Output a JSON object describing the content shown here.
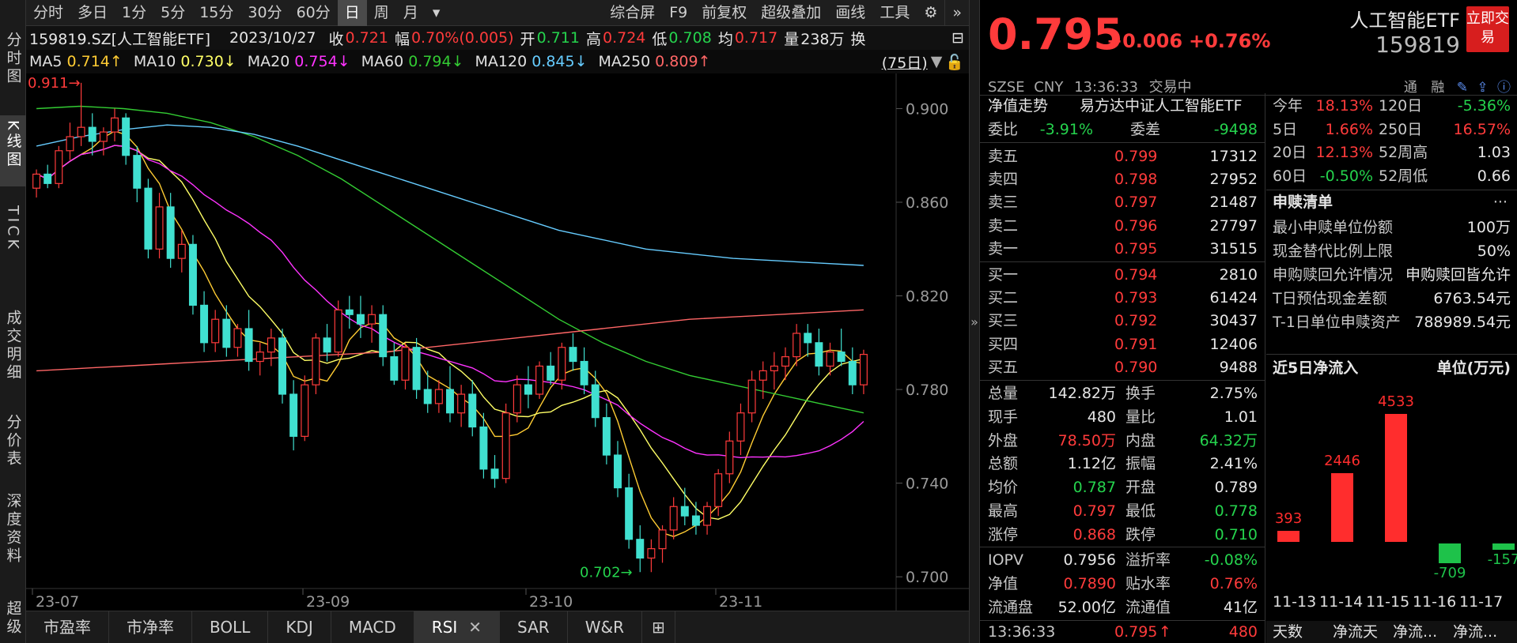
{
  "left_nav": [
    {
      "label": "分时图",
      "active": false
    },
    {
      "label": "K线图",
      "active": true
    },
    {
      "label": "TICK",
      "active": false
    },
    {
      "label": "成交明细",
      "active": false
    },
    {
      "label": "分价表",
      "active": false
    },
    {
      "label": "深度资料",
      "active": false
    },
    {
      "label": "超级",
      "active": false
    }
  ],
  "period_tabs": [
    "分时",
    "多日",
    "1分",
    "5分",
    "15分",
    "30分",
    "60分",
    "日",
    "周",
    "月",
    "▾"
  ],
  "period_active": "日",
  "toolbar": [
    "综合屏",
    "F9",
    "前复权",
    "超级叠加",
    "画线",
    "工具"
  ],
  "info": {
    "code": "159819.SZ[人工智能ETF]",
    "date": "2023/10/27",
    "close_label": "收",
    "close": "0.721",
    "amp_label": "幅",
    "amp": "0.70%(0.005)",
    "open_label": "开",
    "open": "0.711",
    "high_label": "高",
    "high": "0.724",
    "low_label": "低",
    "low": "0.708",
    "avg_label": "均",
    "avg": "0.717",
    "vol_label": "量",
    "vol": "238万",
    "turn_label": "换"
  },
  "ma": [
    {
      "label": "MA5",
      "value": "0.714↑",
      "color": "#ffcc33"
    },
    {
      "label": "MA10",
      "value": "0.730↓",
      "color": "#ffff66"
    },
    {
      "label": "MA20",
      "value": "0.754↓",
      "color": "#ff33ff"
    },
    {
      "label": "MA60",
      "value": "0.794↓",
      "color": "#33cc33"
    },
    {
      "label": "MA120",
      "value": "0.845↓",
      "color": "#66ccff"
    },
    {
      "label": "MA250",
      "value": "0.809↑",
      "color": "#ff6666"
    }
  ],
  "ma_days": "(75日)",
  "chart_data": {
    "type": "candlestick",
    "ylim": [
      0.695,
      0.915
    ],
    "yticks": [
      "0.900",
      "0.860",
      "0.820",
      "0.780",
      "0.740",
      "0.700"
    ],
    "xticks": [
      "23-07",
      "23-09",
      "23-10",
      "23-11"
    ],
    "max_label": "0.911→",
    "min_label": "0.702→",
    "candles": [
      [
        0.866,
        0.874,
        0.862,
        0.872
      ],
      [
        0.872,
        0.876,
        0.866,
        0.868
      ],
      [
        0.868,
        0.884,
        0.866,
        0.882
      ],
      [
        0.882,
        0.894,
        0.878,
        0.888
      ],
      [
        0.888,
        0.911,
        0.884,
        0.892
      ],
      [
        0.892,
        0.898,
        0.88,
        0.886
      ],
      [
        0.886,
        0.892,
        0.88,
        0.89
      ],
      [
        0.89,
        0.9,
        0.886,
        0.896
      ],
      [
        0.896,
        0.898,
        0.876,
        0.88
      ],
      [
        0.88,
        0.884,
        0.86,
        0.866
      ],
      [
        0.866,
        0.87,
        0.836,
        0.84
      ],
      [
        0.84,
        0.864,
        0.836,
        0.858
      ],
      [
        0.858,
        0.864,
        0.832,
        0.836
      ],
      [
        0.836,
        0.848,
        0.83,
        0.842
      ],
      [
        0.842,
        0.846,
        0.812,
        0.816
      ],
      [
        0.816,
        0.822,
        0.796,
        0.8
      ],
      [
        0.8,
        0.814,
        0.796,
        0.81
      ],
      [
        0.81,
        0.816,
        0.794,
        0.798
      ],
      [
        0.798,
        0.808,
        0.794,
        0.806
      ],
      [
        0.806,
        0.814,
        0.788,
        0.792
      ],
      [
        0.792,
        0.8,
        0.786,
        0.796
      ],
      [
        0.796,
        0.806,
        0.79,
        0.802
      ],
      [
        0.802,
        0.806,
        0.774,
        0.778
      ],
      [
        0.778,
        0.784,
        0.754,
        0.76
      ],
      [
        0.76,
        0.786,
        0.758,
        0.782
      ],
      [
        0.782,
        0.804,
        0.778,
        0.802
      ],
      [
        0.802,
        0.808,
        0.792,
        0.796
      ],
      [
        0.796,
        0.818,
        0.794,
        0.814
      ],
      [
        0.814,
        0.82,
        0.806,
        0.812
      ],
      [
        0.812,
        0.82,
        0.802,
        0.808
      ],
      [
        0.808,
        0.816,
        0.8,
        0.812
      ],
      [
        0.812,
        0.816,
        0.79,
        0.794
      ],
      [
        0.794,
        0.8,
        0.782,
        0.784
      ],
      [
        0.784,
        0.8,
        0.78,
        0.798
      ],
      [
        0.798,
        0.802,
        0.776,
        0.78
      ],
      [
        0.78,
        0.788,
        0.77,
        0.774
      ],
      [
        0.774,
        0.784,
        0.77,
        0.78
      ],
      [
        0.78,
        0.79,
        0.766,
        0.77
      ],
      [
        0.77,
        0.782,
        0.764,
        0.778
      ],
      [
        0.778,
        0.784,
        0.76,
        0.764
      ],
      [
        0.764,
        0.77,
        0.742,
        0.746
      ],
      [
        0.746,
        0.752,
        0.738,
        0.742
      ],
      [
        0.742,
        0.774,
        0.74,
        0.77
      ],
      [
        0.77,
        0.786,
        0.766,
        0.782
      ],
      [
        0.782,
        0.79,
        0.772,
        0.778
      ],
      [
        0.778,
        0.792,
        0.776,
        0.79
      ],
      [
        0.79,
        0.796,
        0.782,
        0.784
      ],
      [
        0.784,
        0.8,
        0.78,
        0.798
      ],
      [
        0.798,
        0.804,
        0.788,
        0.792
      ],
      [
        0.792,
        0.798,
        0.778,
        0.782
      ],
      [
        0.782,
        0.788,
        0.764,
        0.768
      ],
      [
        0.768,
        0.774,
        0.748,
        0.752
      ],
      [
        0.752,
        0.758,
        0.734,
        0.738
      ],
      [
        0.738,
        0.744,
        0.712,
        0.716
      ],
      [
        0.716,
        0.722,
        0.702,
        0.708
      ],
      [
        0.708,
        0.716,
        0.702,
        0.712
      ],
      [
        0.712,
        0.722,
        0.706,
        0.72
      ],
      [
        0.72,
        0.734,
        0.716,
        0.73
      ],
      [
        0.73,
        0.738,
        0.722,
        0.726
      ],
      [
        0.726,
        0.732,
        0.718,
        0.722
      ],
      [
        0.722,
        0.732,
        0.718,
        0.73
      ],
      [
        0.73,
        0.746,
        0.726,
        0.744
      ],
      [
        0.744,
        0.762,
        0.74,
        0.758
      ],
      [
        0.758,
        0.774,
        0.752,
        0.77
      ],
      [
        0.77,
        0.788,
        0.766,
        0.784
      ],
      [
        0.784,
        0.792,
        0.776,
        0.788
      ],
      [
        0.788,
        0.796,
        0.78,
        0.79
      ],
      [
        0.79,
        0.798,
        0.784,
        0.794
      ],
      [
        0.794,
        0.808,
        0.79,
        0.804
      ],
      [
        0.804,
        0.808,
        0.794,
        0.8
      ],
      [
        0.8,
        0.806,
        0.786,
        0.79
      ],
      [
        0.79,
        0.8,
        0.786,
        0.796
      ],
      [
        0.796,
        0.806,
        0.79,
        0.792
      ],
      [
        0.792,
        0.798,
        0.778,
        0.782
      ],
      [
        0.782,
        0.797,
        0.778,
        0.795
      ]
    ],
    "ma_lines": [
      {
        "name": "MA5",
        "color": "#ffcc33"
      },
      {
        "name": "MA10",
        "color": "#ffff66"
      },
      {
        "name": "MA20",
        "color": "#ff33ff"
      },
      {
        "name": "MA60",
        "color": "#33cc33",
        "values": [
          0.9,
          0.901,
          0.9,
          0.898,
          0.894,
          0.888,
          0.88,
          0.87,
          0.858,
          0.846,
          0.834,
          0.822,
          0.81,
          0.8,
          0.792,
          0.786,
          0.782,
          0.778,
          0.774,
          0.77
        ]
      },
      {
        "name": "MA120",
        "color": "#66ccff",
        "values": [
          0.884,
          0.888,
          0.891,
          0.893,
          0.892,
          0.889,
          0.884,
          0.878,
          0.872,
          0.866,
          0.86,
          0.854,
          0.848,
          0.844,
          0.84,
          0.838,
          0.836,
          0.835,
          0.834,
          0.833
        ]
      },
      {
        "name": "MA250",
        "color": "#ff6666",
        "values": [
          0.788,
          0.789,
          0.79,
          0.791,
          0.792,
          0.793,
          0.794,
          0.795,
          0.796,
          0.798,
          0.8,
          0.802,
          0.804,
          0.806,
          0.808,
          0.81,
          0.811,
          0.812,
          0.813,
          0.814
        ]
      }
    ]
  },
  "indicator_tabs": [
    "市盈率",
    "市净率",
    "BOLL",
    "KDJ",
    "MACD",
    "RSI",
    "SAR",
    "W&R"
  ],
  "indicator_active": "RSI",
  "quote": {
    "price": "0.795",
    "change": "+0.006",
    "change_pct": "+0.76%",
    "name": "人工智能ETF",
    "code": "159819",
    "trade_btn": "立即交易",
    "exchange": "SZSE",
    "currency": "CNY",
    "time": "13:36:33",
    "status": "交易中",
    "tags": [
      "通",
      "融"
    ]
  },
  "fund": {
    "tab1": "净值走势",
    "tab2": "易方达中证人工智能ETF"
  },
  "weibi": {
    "label1": "委比",
    "value1": "-3.91%",
    "label2": "委差",
    "value2": "-9498"
  },
  "asks": [
    {
      "label": "卖五",
      "price": "0.799",
      "vol": "17312"
    },
    {
      "label": "卖四",
      "price": "0.798",
      "vol": "27952"
    },
    {
      "label": "卖三",
      "price": "0.797",
      "vol": "21487"
    },
    {
      "label": "卖二",
      "price": "0.796",
      "vol": "27797"
    },
    {
      "label": "卖一",
      "price": "0.795",
      "vol": "31515"
    }
  ],
  "bids": [
    {
      "label": "买一",
      "price": "0.794",
      "vol": "2810"
    },
    {
      "label": "买二",
      "price": "0.793",
      "vol": "61424"
    },
    {
      "label": "买三",
      "price": "0.792",
      "vol": "30437"
    },
    {
      "label": "买四",
      "price": "0.791",
      "vol": "12406"
    },
    {
      "label": "买五",
      "price": "0.790",
      "vol": "9488"
    }
  ],
  "stats": [
    {
      "l1": "总量",
      "v1": "142.82万",
      "c1": "white",
      "l2": "换手",
      "v2": "2.75%",
      "c2": "white"
    },
    {
      "l1": "现手",
      "v1": "480",
      "c1": "white",
      "l2": "量比",
      "v2": "1.01",
      "c2": "white"
    },
    {
      "l1": "外盘",
      "v1": "78.50万",
      "c1": "red",
      "l2": "内盘",
      "v2": "64.32万",
      "c2": "green"
    },
    {
      "l1": "总额",
      "v1": "1.12亿",
      "c1": "white",
      "l2": "振幅",
      "v2": "2.41%",
      "c2": "white"
    },
    {
      "l1": "均价",
      "v1": "0.787",
      "c1": "green",
      "l2": "开盘",
      "v2": "0.789",
      "c2": "white"
    },
    {
      "l1": "最高",
      "v1": "0.797",
      "c1": "red",
      "l2": "最低",
      "v2": "0.778",
      "c2": "green"
    },
    {
      "l1": "涨停",
      "v1": "0.868",
      "c1": "red",
      "l2": "跌停",
      "v2": "0.710",
      "c2": "green"
    }
  ],
  "iopv": [
    {
      "l1": "IOPV",
      "v1": "0.7956",
      "c1": "white",
      "l2": "溢折率",
      "v2": "-0.08%",
      "c2": "green"
    },
    {
      "l1": "净值",
      "v1": "0.7890",
      "c1": "red",
      "l2": "贴水率",
      "v2": "0.76%",
      "c2": "red"
    },
    {
      "l1": "流通盘",
      "v1": "52.00亿",
      "c1": "white",
      "l2": "流通值",
      "v2": "41亿",
      "c2": "white"
    }
  ],
  "last_trade": {
    "time": "13:36:33",
    "price": "0.795",
    "arrow": "↑",
    "vol": "480"
  },
  "perf": [
    {
      "l1": "今年",
      "v1": "18.13%",
      "c1": "red",
      "l2": "120日",
      "v2": "-5.36%",
      "c2": "green"
    },
    {
      "l1": "5日",
      "v1": "1.66%",
      "c1": "red",
      "l2": "250日",
      "v2": "16.57%",
      "c2": "red"
    },
    {
      "l1": "20日",
      "v1": "12.13%",
      "c1": "red",
      "l2": "52周高",
      "v2": "1.03",
      "c2": "white"
    },
    {
      "l1": "60日",
      "v1": "-0.50%",
      "c1": "green",
      "l2": "52周低",
      "v2": "0.66",
      "c2": "white"
    }
  ],
  "subscription": {
    "title": "申赎清单",
    "more": "···",
    "rows": [
      {
        "label": "最小申赎单位份额",
        "value": "100万"
      },
      {
        "label": "现金替代比例上限",
        "value": "50%"
      },
      {
        "label": "申购赎回允许情况",
        "value": "申购赎回皆允许"
      },
      {
        "label": "T日预估现金差额",
        "value": "6763.54元"
      },
      {
        "label": "T-1日单位申赎资产",
        "value": "788989.54元"
      }
    ]
  },
  "flow": {
    "title": "近5日净流入",
    "unit": "单位(万元)",
    "labels": [
      "11-13",
      "11-14",
      "11-15",
      "11-16",
      "11-17"
    ],
    "values": [
      393,
      2446,
      4533,
      -709,
      -157
    ],
    "footer": [
      "天数",
      "净流天",
      "净流...",
      "净流..."
    ]
  }
}
